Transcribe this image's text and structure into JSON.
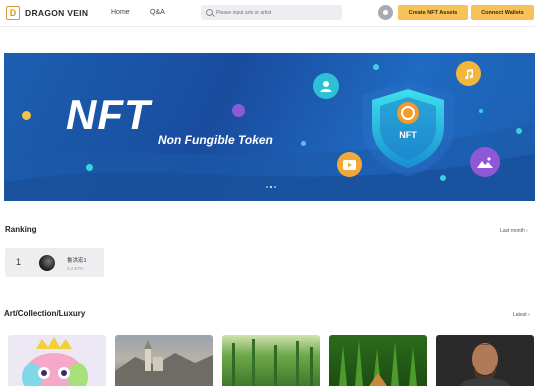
{
  "header": {
    "logo_text": "DRAGON VEIN",
    "nav": [
      "Home",
      "Q&A"
    ],
    "search_placeholder": "Please input arts or artist",
    "create_label": "Create NFT Assets",
    "connect_label": "Connect Wallets"
  },
  "banner": {
    "title": "NFT",
    "subtitle": "Non Fungible Token",
    "shield_label": "NFT"
  },
  "ranking": {
    "title": "Ranking",
    "filter": "Last month",
    "items": [
      {
        "rank": "1",
        "name": "鲁洪宏1",
        "amount": "0.2 ETH"
      }
    ]
  },
  "collection": {
    "title": "Art/Collection/Luxury",
    "filter": "Latest"
  }
}
